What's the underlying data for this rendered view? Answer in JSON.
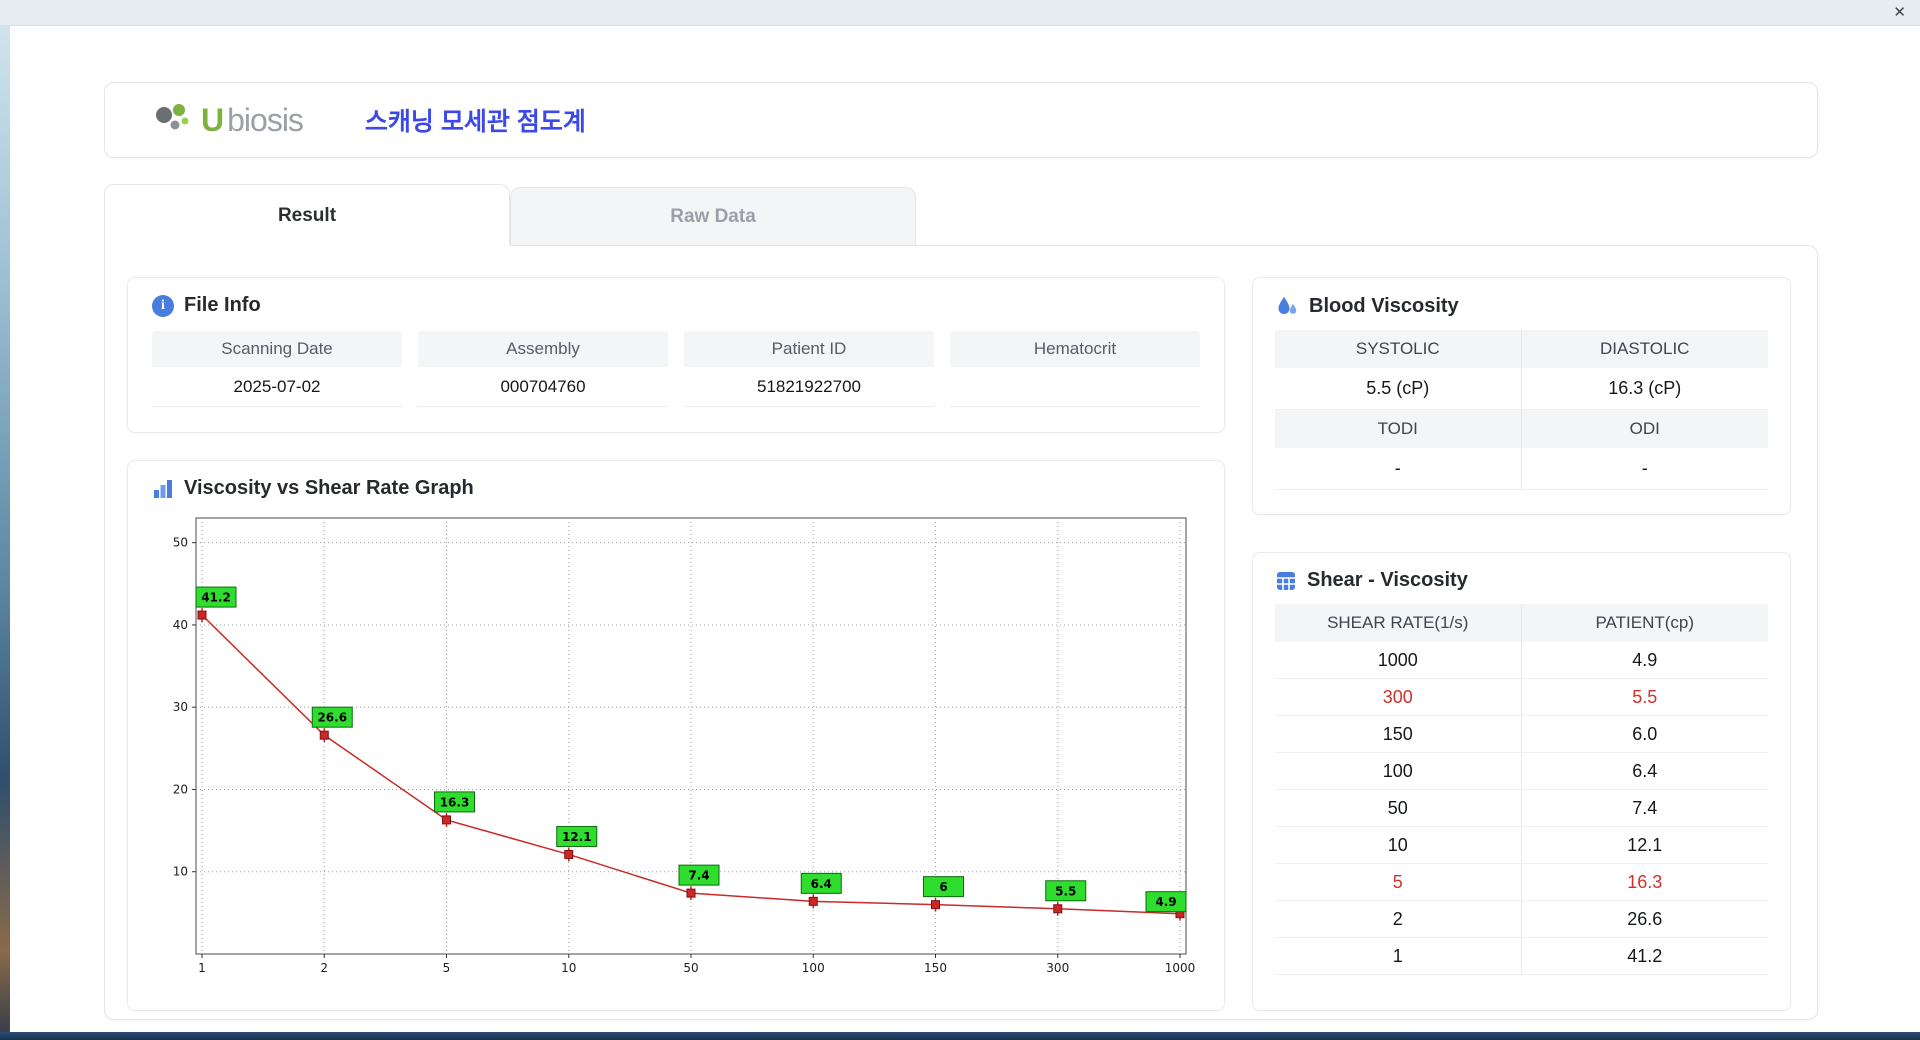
{
  "window": {
    "close_label": "✕"
  },
  "header": {
    "logo_u": "U",
    "logo_rest": "biosis",
    "title": "스캐닝 모세관 점도계"
  },
  "tabs": [
    {
      "label": "Result"
    },
    {
      "label": "Raw Data"
    }
  ],
  "file_info": {
    "title": "File Info",
    "fields": [
      {
        "label": "Scanning Date",
        "value": "2025-07-02"
      },
      {
        "label": "Assembly",
        "value": "000704760"
      },
      {
        "label": "Patient ID",
        "value": "51821922700"
      },
      {
        "label": "Hematocrit",
        "value": ""
      }
    ]
  },
  "graph_panel": {
    "title": "Viscosity vs Shear Rate Graph"
  },
  "blood_viscosity": {
    "title": "Blood Viscosity",
    "row1": [
      {
        "header": "SYSTOLIC",
        "value": "5.5 (cP)"
      },
      {
        "header": "DIASTOLIC",
        "value": "16.3 (cP)"
      }
    ],
    "row2": [
      {
        "header": "TODI",
        "value": "-"
      },
      {
        "header": "ODI",
        "value": "-"
      }
    ]
  },
  "shear_table": {
    "title": "Shear - Viscosity",
    "headers": [
      "SHEAR RATE(1/s)",
      "PATIENT(cp)"
    ],
    "rows": [
      {
        "shear": "1000",
        "patient": "4.9",
        "highlight": false
      },
      {
        "shear": "300",
        "patient": "5.5",
        "highlight": true
      },
      {
        "shear": "150",
        "patient": "6.0",
        "highlight": false
      },
      {
        "shear": "100",
        "patient": "6.4",
        "highlight": false
      },
      {
        "shear": "50",
        "patient": "7.4",
        "highlight": false
      },
      {
        "shear": "10",
        "patient": "12.1",
        "highlight": false
      },
      {
        "shear": "5",
        "patient": "16.3",
        "highlight": true
      },
      {
        "shear": "2",
        "patient": "26.6",
        "highlight": false
      },
      {
        "shear": "1",
        "patient": "41.2",
        "highlight": false
      }
    ]
  },
  "chart_data": {
    "type": "line",
    "title": "Viscosity vs Shear Rate Graph",
    "categories": [
      1,
      2,
      5,
      10,
      50,
      100,
      150,
      300,
      1000
    ],
    "values": [
      41.2,
      26.6,
      16.3,
      12.1,
      7.4,
      6.4,
      6,
      5.5,
      4.9
    ],
    "labels": [
      "41.2",
      "26.6",
      "16.3",
      "12.1",
      "7.4",
      "6.4",
      "6",
      "5.5",
      "4.9"
    ],
    "xlabel": "",
    "ylabel": "",
    "yticks": [
      10,
      20,
      30,
      40,
      50
    ],
    "ylim": [
      0,
      53
    ],
    "x_axis_type": "category",
    "grid": "dotted",
    "legend": "none",
    "line_color": "#c92a2a",
    "marker_color": "#cc2626",
    "marker_stroke": "#7a1212",
    "label_bg": "#2edd2e",
    "label_border": "#0c6b0c"
  },
  "colors": {
    "accent_blue": "#3c49e8",
    "icon_blue": "#4a7de0",
    "highlight_red": "#d2302c",
    "logo_green": "#7cb23e",
    "panel_border": "#e8eaed",
    "header_bg": "#f3f5f7"
  }
}
